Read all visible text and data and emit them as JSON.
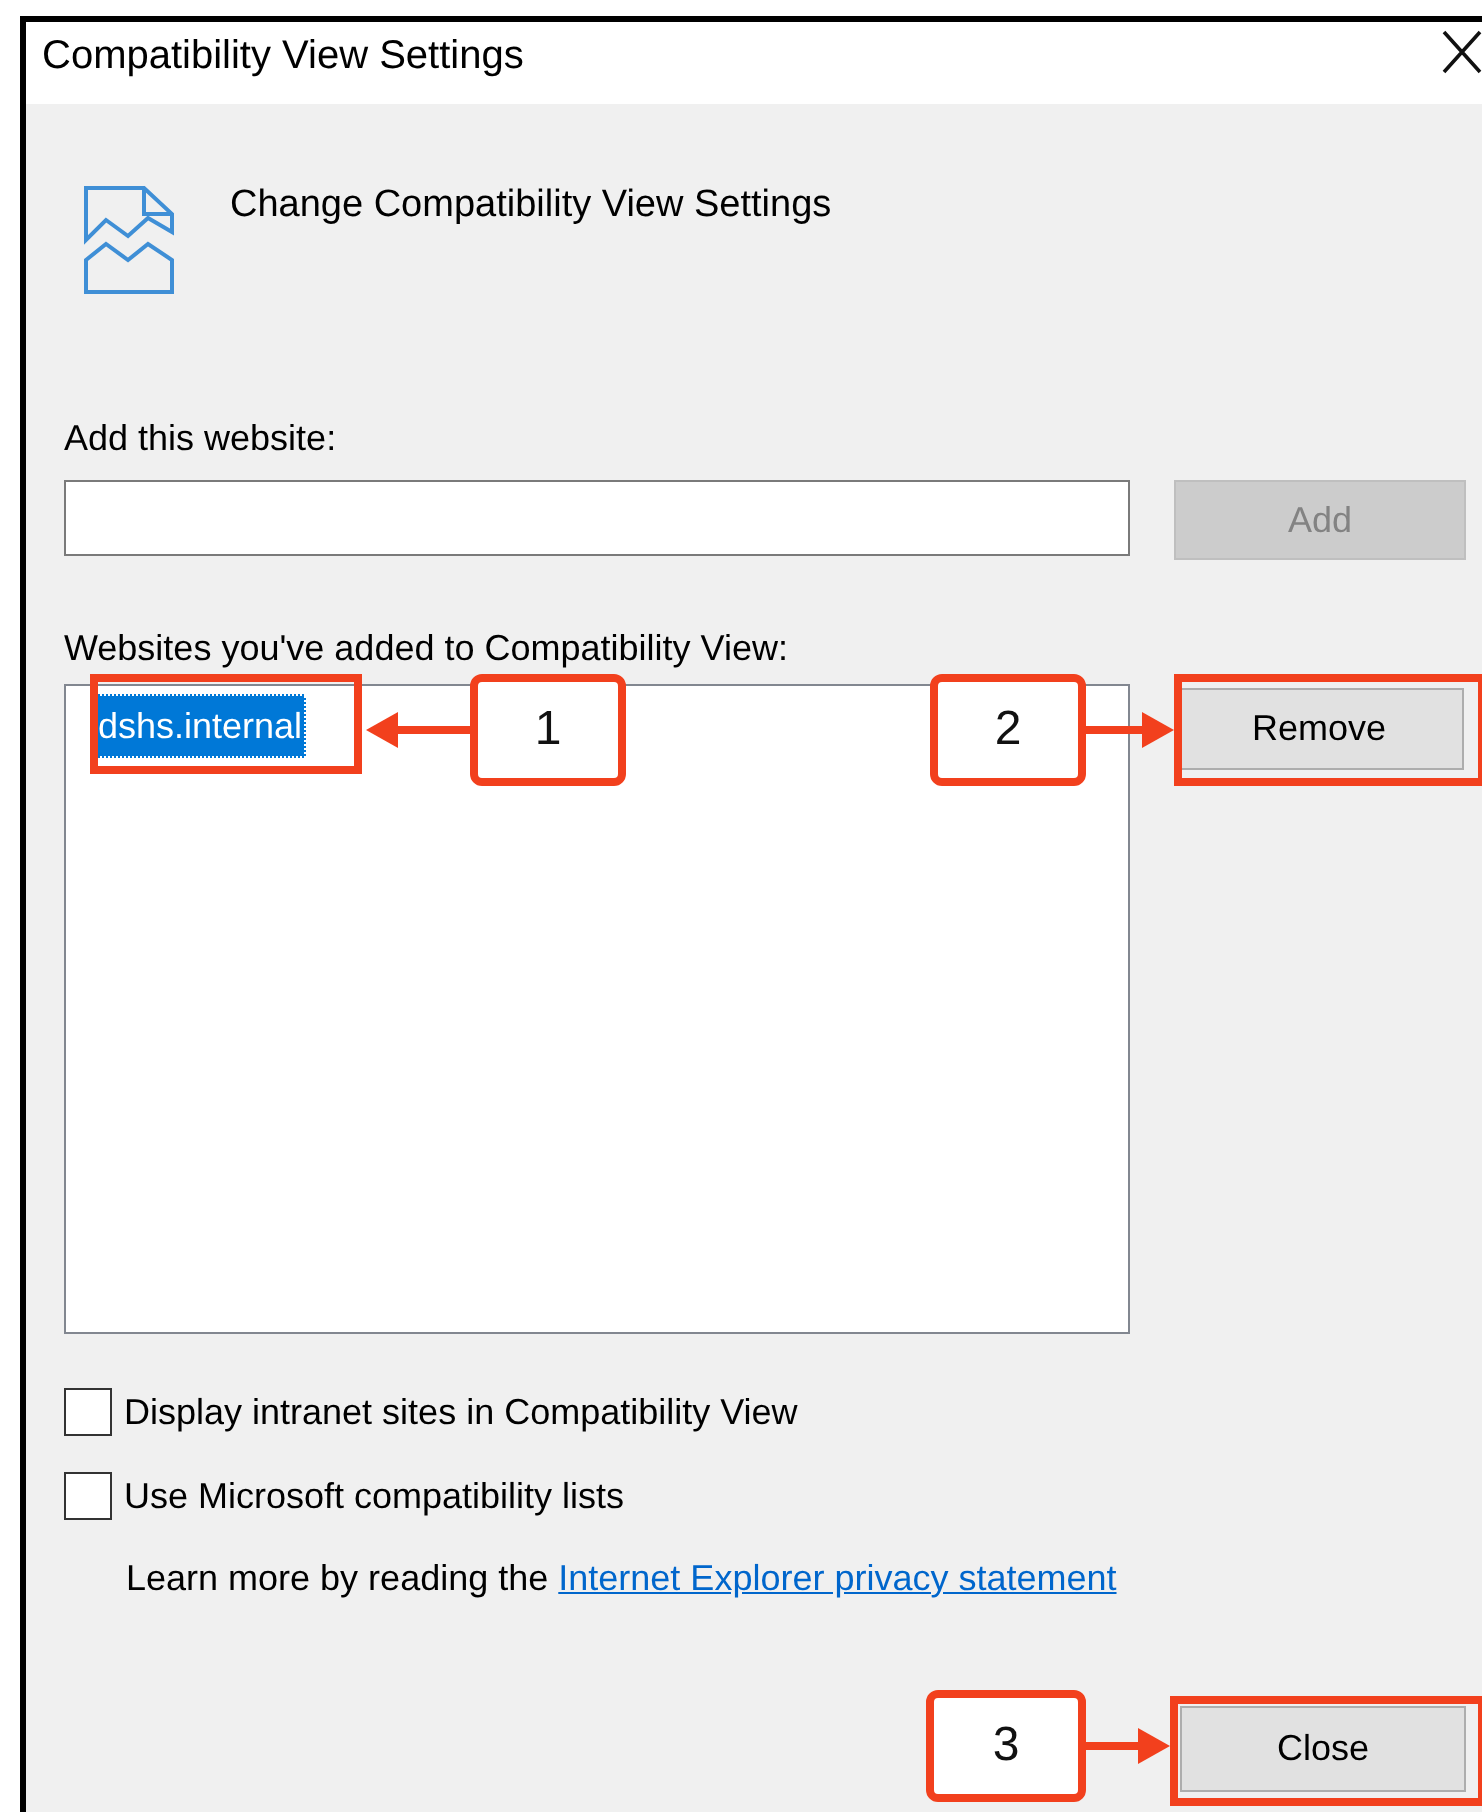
{
  "window": {
    "title": "Compatibility View Settings"
  },
  "heading": "Change Compatibility View Settings",
  "add_website": {
    "label": "Add this website:",
    "button": {
      "label": "Add",
      "disabled": true
    }
  },
  "websites": {
    "label": "Websites you've added to Compatibility View:",
    "items": [
      {
        "text": "dshs.internal",
        "selected": true
      }
    ],
    "button": {
      "label": "Remove",
      "disabled": false
    }
  },
  "options": [
    {
      "label": "Display intranet sites in Compatibility View",
      "checked": false
    },
    {
      "label": "Use Microsoft compatibility lists",
      "checked": false
    }
  ],
  "privacy_note": {
    "text": "Learn more by reading the",
    "link": "Internet Explorer privacy statement"
  },
  "buttons": [
    {
      "label": "Close",
      "disabled": false
    }
  ],
  "annotations": [
    {
      "label": "1"
    },
    {
      "label": "2"
    },
    {
      "label": "3"
    }
  ]
}
